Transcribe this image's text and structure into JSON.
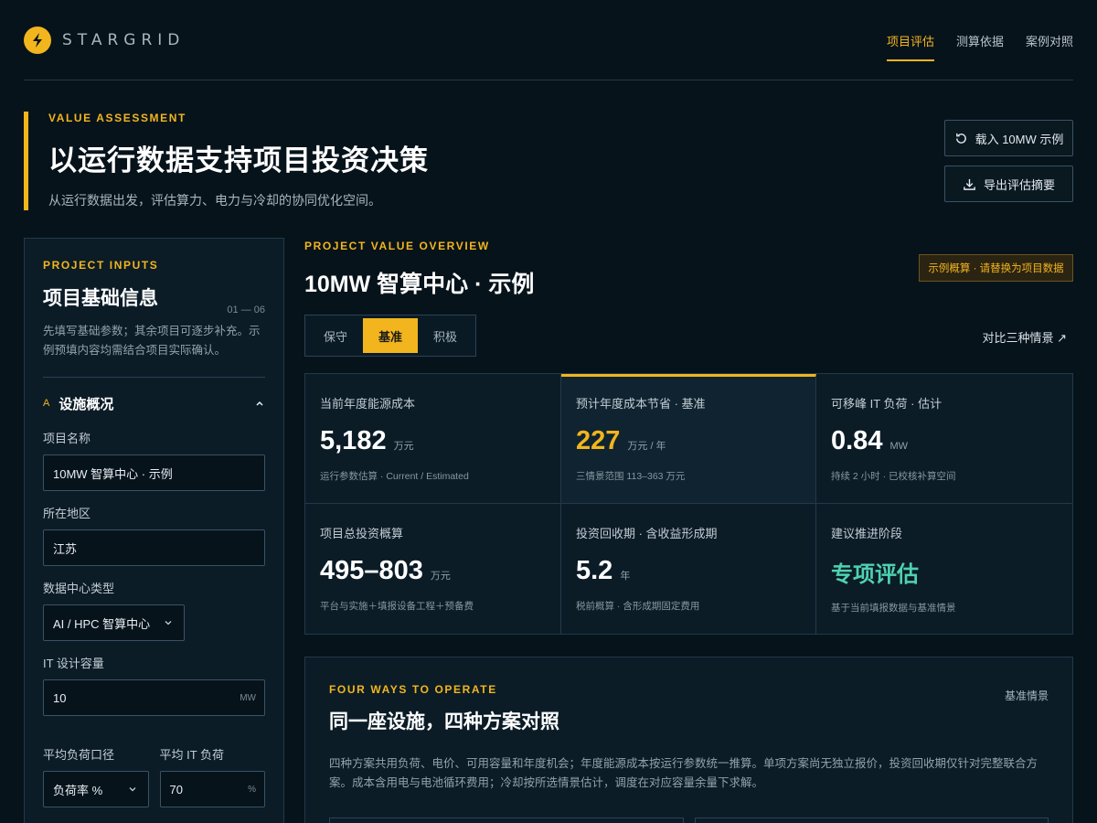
{
  "header": {
    "brand": "STARGRID",
    "nav": [
      {
        "label": "项目评估",
        "active": true
      },
      {
        "label": "测算依据",
        "active": false
      },
      {
        "label": "案例对照",
        "active": false
      }
    ]
  },
  "hero": {
    "eyebrow": "VALUE ASSESSMENT",
    "title": "以运行数据支持项目投资决策",
    "subtitle": "从运行数据出发，评估算力、电力与冷却的协同优化空间。",
    "buttons": {
      "load_example": "载入 10MW 示例",
      "export_summary": "导出评估摘要"
    }
  },
  "inputs_panel": {
    "eyebrow": "PROJECT INPUTS",
    "title": "项目基础信息",
    "step": "01 — 06",
    "description": "先填写基础参数；其余项目可逐步补充。示例预填内容均需结合项目实际确认。",
    "section": {
      "letter": "A",
      "title": "设施概况"
    },
    "fields": {
      "project_name": {
        "label": "项目名称",
        "value": "10MW 智算中心 · 示例"
      },
      "region": {
        "label": "所在地区",
        "value": "江苏"
      },
      "dc_type": {
        "label": "数据中心类型",
        "value": "AI / HPC 智算中心"
      },
      "it_capacity": {
        "label": "IT 设计容量",
        "value": "10",
        "unit": "MW"
      },
      "load_basis": {
        "label": "平均负荷口径",
        "value": "负荷率 %"
      },
      "avg_it_load": {
        "label": "平均 IT 负荷",
        "value": "70",
        "unit": "%"
      }
    }
  },
  "overview": {
    "eyebrow": "PROJECT VALUE OVERVIEW",
    "title": "10MW 智算中心 · 示例",
    "badge": "示例概算 · 请替换为项目数据",
    "scenarios": [
      {
        "label": "保守",
        "active": false
      },
      {
        "label": "基准",
        "active": true
      },
      {
        "label": "积极",
        "active": false
      }
    ],
    "compare_link": "对比三种情景 ↗",
    "metrics": [
      {
        "label": "当前年度能源成本",
        "value": "5,182",
        "unit": "万元",
        "note": "运行参数估算 · Current / Estimated",
        "style": "normal"
      },
      {
        "label": "预计年度成本节省 · 基准",
        "value": "227",
        "unit": "万元 / 年",
        "note": "三情景范围 113–363 万元",
        "style": "gold"
      },
      {
        "label": "可移峰 IT 负荷 · 估计",
        "value": "0.84",
        "unit": "MW",
        "note": "持续 2 小时 · 已校核补算空间",
        "style": "normal"
      },
      {
        "label": "项目总投资概算",
        "value": "495–803",
        "unit": "万元",
        "note": "平台与实施＋填报设备工程＋预备费",
        "style": "normal"
      },
      {
        "label": "投资回收期 · 含收益形成期",
        "value": "5.2",
        "unit": "年",
        "note": "税前概算 · 含形成期固定费用",
        "style": "normal"
      },
      {
        "label": "建议推进阶段",
        "value": "专项评估",
        "unit": "",
        "note": "基于当前填报数据与基准情景",
        "style": "teal"
      }
    ]
  },
  "four_ways": {
    "eyebrow": "FOUR WAYS TO OPERATE",
    "title": "同一座设施，四种方案对照",
    "tag": "基准情景",
    "description": "四种方案共用负荷、电价、可用容量和年度机会；年度能源成本按运行参数统一推算。单项方案尚无独立报价，投资回收期仅针对完整联合方案。成本含用电与电池循环费用；冷却按所选情景估计，调度在对应容量余量下求解。"
  },
  "colors": {
    "background": "#07131b",
    "panel": "#0b1c27",
    "accent": "#f2b51e",
    "teal": "#4fd1b0",
    "border": "#23384a"
  }
}
